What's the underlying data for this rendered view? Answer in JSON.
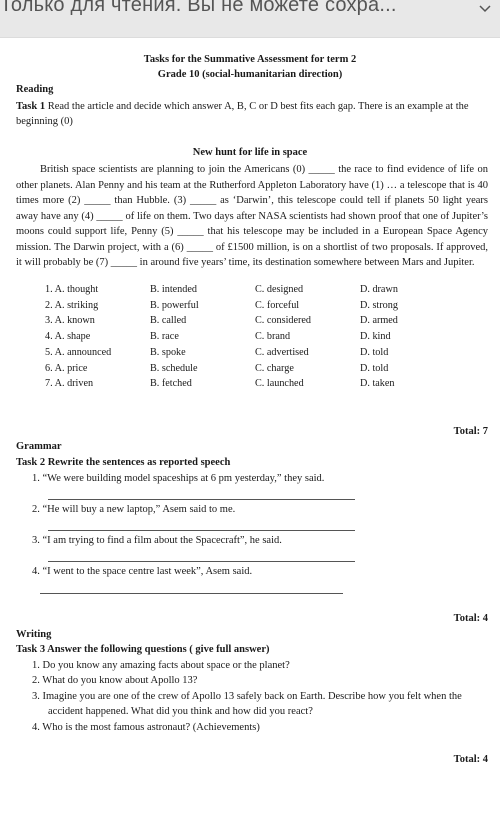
{
  "topbar": {
    "title": "Только для чтения. Вы не можете сохра...",
    "icon": "chevron-down-icon"
  },
  "document": {
    "title_line1": "Tasks for the Summative Assessment for term 2",
    "title_line2": "Grade 10 (social-humanitarian direction)",
    "reading": {
      "heading": "Reading",
      "task_label": "Task 1",
      "task_text": " Read the article and decide which answer A, B, C or D best fits each gap. There is an example at the beginning (0)",
      "article_title": "New hunt for life in space",
      "article_text": "British space scientists are planning to join the Americans (0) _____ the race to find evidence of life on other planets. Alan Penny and his team at the Rutherford Appleton Laboratory have (1) … a telescope that is 40 times more (2) _____ than Hubble. (3) _____ as ‘Darwin’, this telescope could tell if planets 50 light years away have any (4) _____ of life on them. Two days after NASA scientists had shown proof that one of Jupiter’s moons could support life, Penny (5) _____ that his telescope may be included in a European Space Agency mission. The Darwin project, with a (6) _____ of £1500 million, is on a shortlist of two proposals. If approved, it will probably be (7) _____ in around five years’ time, its destination somewhere between Mars and Jupiter.",
      "options": [
        {
          "a": "1. A. thought",
          "b": "B. intended",
          "c": "C. designed",
          "d": "D. drawn"
        },
        {
          "a": "2. A. striking",
          "b": "B. powerful",
          "c": "C. forceful",
          "d": "D. strong"
        },
        {
          "a": "3. A. known",
          "b": "B. called",
          "c": "C. considered",
          "d": "D. armed"
        },
        {
          "a": "4. A. shape",
          "b": "B. race",
          "c": "C. brand",
          "d": "D. kind"
        },
        {
          "a": "5. A. announced",
          "b": "B. spoke",
          "c": "C. advertised",
          "d": "D. told"
        },
        {
          "a": "6. A. price",
          "b": "B. schedule",
          "c": "C. charge",
          "d": "D. told"
        },
        {
          "a": "7. A. driven",
          "b": "B. fetched",
          "c": "C. launched",
          "d": "D. taken"
        }
      ],
      "total": "Total: 7"
    },
    "grammar": {
      "heading": "Grammar",
      "task": "Task 2   Rewrite the sentences as reported speech",
      "items": [
        "1. “We were building model spaceships at 6 pm yesterday,” they said.",
        "2. “He will buy a new laptop,” Asem said to me.",
        "3. “I am trying to find a film about the Spacecraft”, he said.",
        "4. “I went to the space centre last week”, Asem said."
      ],
      "total": "Total: 4"
    },
    "writing": {
      "heading": "Writing",
      "task": "Task 3 Answer the following questions ( give full answer)",
      "items": [
        "1. Do you know any amazing facts about space or the planet?",
        "2. What do you know about Apollo 13?",
        "3. Imagine you are one of the crew of Apollo 13 safely back on Earth. Describe how you felt when the",
        "accident happened. What did you think and how did you react?",
        "4. Who is the most famous astronaut? (Achievements)"
      ],
      "total": "Total: 4"
    }
  }
}
